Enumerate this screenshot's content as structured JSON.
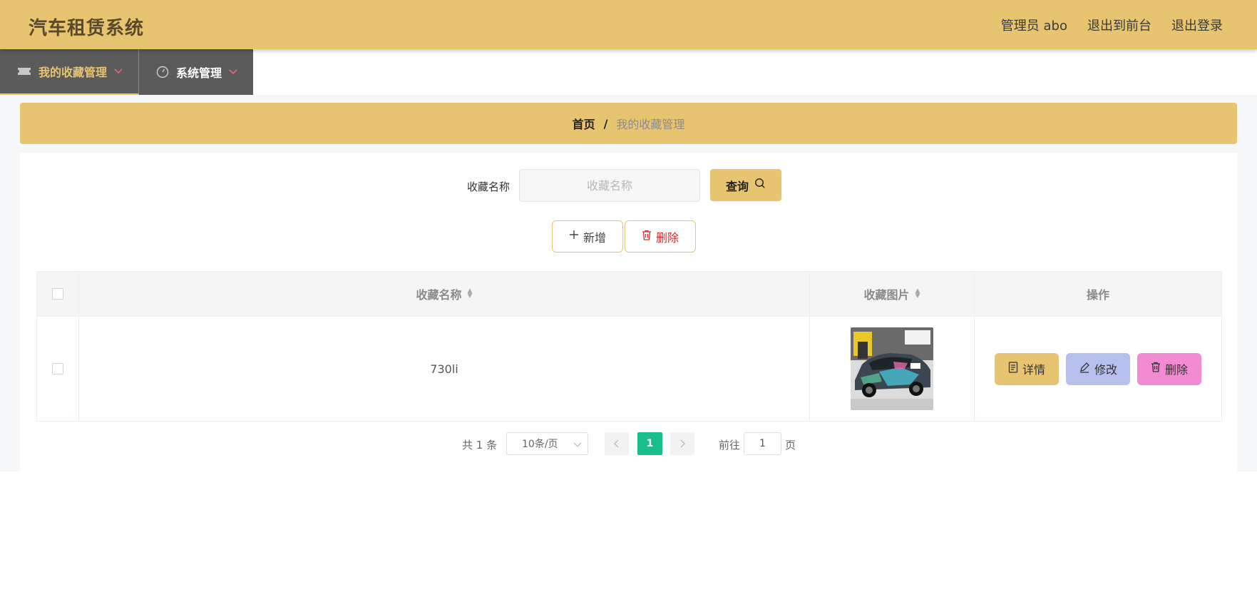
{
  "header": {
    "title": "汽车租赁系统",
    "admin": "管理员 abo",
    "back_front": "退出到前台",
    "logout": "退出登录"
  },
  "nav": {
    "items": [
      {
        "label": "我的收藏管理",
        "icon": "ticket-icon",
        "active": true
      },
      {
        "label": "系统管理",
        "icon": "gauge-icon",
        "active": false
      }
    ]
  },
  "breadcrumb": {
    "home": "首页",
    "separator": "/",
    "current": "我的收藏管理"
  },
  "search": {
    "label": "收藏名称",
    "placeholder": "收藏名称",
    "value": "",
    "button": "查询"
  },
  "toolbar": {
    "add": "新增",
    "delete": "删除"
  },
  "table": {
    "headers": [
      "收藏名称",
      "收藏图片",
      "操作"
    ],
    "rows": [
      {
        "name": "730li",
        "image": "car-photo",
        "actions": [
          "详情",
          "修改",
          "删除"
        ]
      }
    ]
  },
  "pagination": {
    "total": "共 1 条",
    "page_size": "10条/页",
    "current_page": "1",
    "goto_label": "前往",
    "goto_value": "1",
    "page_suffix": "页"
  },
  "colors": {
    "accent": "#e7c46f",
    "nav_bg": "#5b5b5b",
    "active_page": "#19be8b",
    "edit": "#b7c0ec",
    "delete": "#f28bd2",
    "danger_text": "#d22d2d"
  }
}
